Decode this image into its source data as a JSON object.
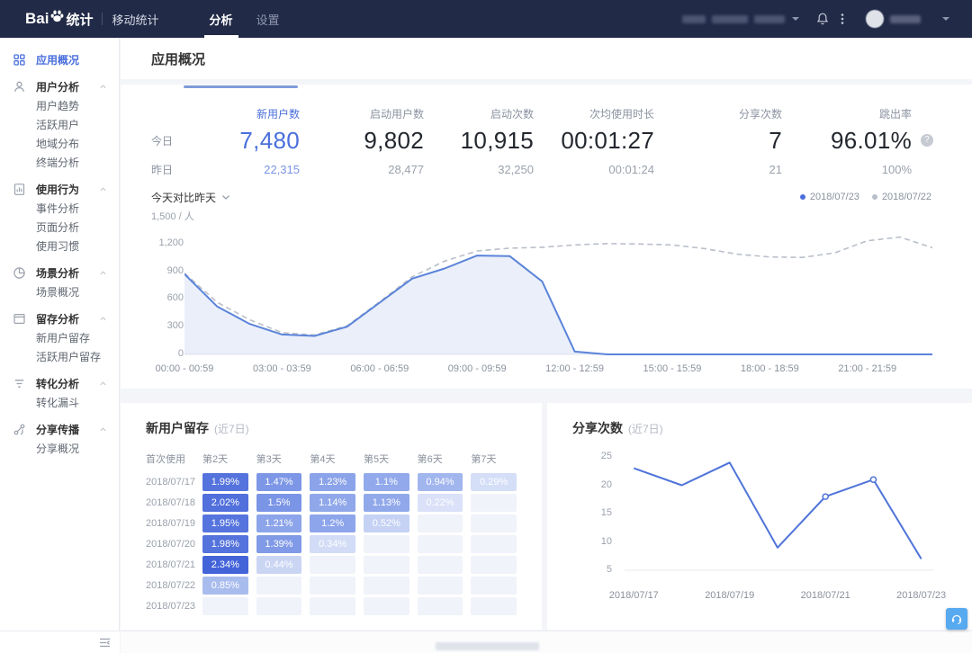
{
  "navbar": {
    "brand": {
      "bai": "Bai",
      "tongji": "统计",
      "product": "移动统计"
    },
    "tabs": [
      {
        "id": "analysis",
        "label": "分析",
        "active": true
      },
      {
        "id": "settings",
        "label": "设置",
        "active": false
      }
    ],
    "right": {
      "redacted": true,
      "bell_icon": "bell-icon",
      "more_icon": "kebab-menu-icon",
      "avatar_icon": "user-avatar",
      "dropdown_icon": "chevron-down-icon"
    }
  },
  "sidebar": {
    "sections": [
      {
        "id": "app-overview",
        "icon": "grid-icon",
        "label": "应用概况",
        "active": true,
        "children": []
      },
      {
        "id": "user-analysis",
        "icon": "user-icon",
        "label": "用户分析",
        "children": [
          "用户趋势",
          "活跃用户",
          "地域分布",
          "终端分析"
        ]
      },
      {
        "id": "usage-behavior",
        "icon": "behavior-icon",
        "label": "使用行为",
        "children": [
          "事件分析",
          "页面分析",
          "使用习惯"
        ]
      },
      {
        "id": "scene-analysis",
        "icon": "scene-icon",
        "label": "场景分析",
        "children": [
          "场景概况"
        ]
      },
      {
        "id": "retention-analysis",
        "icon": "retention-icon",
        "label": "留存分析",
        "children": [
          "新用户留存",
          "活跃用户留存"
        ]
      },
      {
        "id": "conversion-analysis",
        "icon": "funnel-icon",
        "label": "转化分析",
        "children": [
          "转化漏斗"
        ]
      },
      {
        "id": "share-spread",
        "icon": "share-icon",
        "label": "分享传播",
        "children": [
          "分享概况"
        ]
      }
    ]
  },
  "page": {
    "title": "应用概况"
  },
  "metrics": {
    "row_labels": {
      "today": "今日",
      "yesterday": "昨日"
    },
    "columns": [
      {
        "id": "new-users",
        "label": "新用户数",
        "today": "7,480",
        "yesterday": "22,315",
        "accent": true
      },
      {
        "id": "launch-users",
        "label": "启动用户数",
        "today": "9,802",
        "yesterday": "28,477"
      },
      {
        "id": "launch-count",
        "label": "启动次数",
        "today": "10,915",
        "yesterday": "32,250"
      },
      {
        "id": "avg-duration",
        "label": "次均使用时长",
        "today": "00:01:27",
        "yesterday": "00:01:24"
      },
      {
        "id": "share-count",
        "label": "分享次数",
        "today": "7",
        "yesterday": "21"
      },
      {
        "id": "bounce-rate",
        "label": "跳出率",
        "today": "96.01%",
        "yesterday": "100%",
        "help": true
      }
    ]
  },
  "compare": {
    "dropdown_label": "今天对比昨天",
    "legend": [
      {
        "label": "2018/07/23",
        "color": "#4a6fdc"
      },
      {
        "label": "2018/07/22",
        "color": "#b9bfc9"
      }
    ]
  },
  "chart_data": [
    {
      "id": "hourly-compare",
      "type": "line",
      "title": "今天对比昨天",
      "unit_label": "1,500 / 人",
      "ylim": [
        0,
        1500
      ],
      "y_ticks": [
        1200,
        900,
        600,
        300,
        0
      ],
      "y_tick_labels": [
        "1,200",
        "900",
        "600",
        "300",
        "0"
      ],
      "x_tick_labels": [
        "00:00 - 00:59",
        "03:00 - 03:59",
        "06:00 - 06:59",
        "09:00 - 09:59",
        "12:00 - 12:59",
        "15:00 - 15:59",
        "18:00 - 18:59",
        "21:00 - 21:59"
      ],
      "series": [
        {
          "name": "2018/07/23",
          "style": "solid",
          "color": "#5b84d9",
          "values": [
            870,
            520,
            330,
            215,
            200,
            300,
            560,
            820,
            930,
            1070,
            1065,
            790,
            30,
            0,
            0,
            0,
            0,
            0,
            0,
            0,
            0,
            0,
            0,
            0
          ]
        },
        {
          "name": "2018/07/22",
          "style": "dashed",
          "color": "#b9bfc9",
          "values": [
            880,
            565,
            375,
            235,
            210,
            310,
            570,
            840,
            1010,
            1120,
            1150,
            1160,
            1185,
            1200,
            1195,
            1185,
            1145,
            1085,
            1055,
            1050,
            1100,
            1230,
            1270,
            1155
          ]
        }
      ]
    },
    {
      "id": "new-user-retention",
      "type": "table",
      "title": "新用户留存",
      "subtitle": "(近7日)",
      "columns": [
        "首次使用",
        "第2天",
        "第3天",
        "第4天",
        "第5天",
        "第6天",
        "第7天"
      ],
      "empty_cell_bg": "#f1f3fa",
      "rows": [
        {
          "date": "2018/07/17",
          "cells": [
            {
              "value": "1.99%",
              "bg": "#5573dc"
            },
            {
              "value": "1.47%",
              "bg": "#7d97e6"
            },
            {
              "value": "1.23%",
              "bg": "#8ba3e9"
            },
            {
              "value": "1.1%",
              "bg": "#92aaeb"
            },
            {
              "value": "0.94%",
              "bg": "#a2b6ee"
            },
            {
              "value": "0.29%",
              "bg": "#d4def7"
            }
          ]
        },
        {
          "date": "2018/07/18",
          "cells": [
            {
              "value": "2.02%",
              "bg": "#5170dc"
            },
            {
              "value": "1.5%",
              "bg": "#7b95e6"
            },
            {
              "value": "1.14%",
              "bg": "#90a8ea"
            },
            {
              "value": "1.13%",
              "bg": "#91a9ea"
            },
            {
              "value": "0.22%",
              "bg": "#dae1f8"
            },
            null
          ]
        },
        {
          "date": "2018/07/19",
          "cells": [
            {
              "value": "1.95%",
              "bg": "#5674dd"
            },
            {
              "value": "1.21%",
              "bg": "#8ca4e9"
            },
            {
              "value": "1.2%",
              "bg": "#8da5ea"
            },
            {
              "value": "0.52%",
              "bg": "#c5d2f4"
            },
            null,
            null
          ]
        },
        {
          "date": "2018/07/20",
          "cells": [
            {
              "value": "1.98%",
              "bg": "#5573dc"
            },
            {
              "value": "1.39%",
              "bg": "#819ae7"
            },
            {
              "value": "0.34%",
              "bg": "#d2dcf6"
            },
            null,
            null,
            null
          ]
        },
        {
          "date": "2018/07/21",
          "cells": [
            {
              "value": "2.34%",
              "bg": "#4364d9"
            },
            {
              "value": "0.44%",
              "bg": "#cad5f4"
            },
            null,
            null,
            null,
            null
          ]
        },
        {
          "date": "2018/07/22",
          "cells": [
            {
              "value": "0.85%",
              "bg": "#a9bcee"
            },
            null,
            null,
            null,
            null,
            null
          ]
        },
        {
          "date": "2018/07/23",
          "cells": [
            null,
            null,
            null,
            null,
            null,
            null
          ]
        }
      ]
    },
    {
      "id": "share-count-7d",
      "type": "line",
      "title": "分享次数",
      "subtitle": "(近7日)",
      "color": "#4f74d9",
      "x": [
        "2018/07/17",
        "2018/07/18",
        "2018/07/19",
        "2018/07/20",
        "2018/07/21",
        "2018/07/22",
        "2018/07/23"
      ],
      "values": [
        23,
        20,
        24,
        9,
        18,
        21,
        7
      ],
      "x_tick_labels": [
        "2018/07/17",
        "2018/07/19",
        "2018/07/21",
        "2018/07/23"
      ],
      "y_ticks": [
        25,
        20,
        15,
        10,
        5
      ],
      "ylim": [
        5,
        25
      ],
      "marker_indices": [
        4,
        5
      ]
    }
  ]
}
